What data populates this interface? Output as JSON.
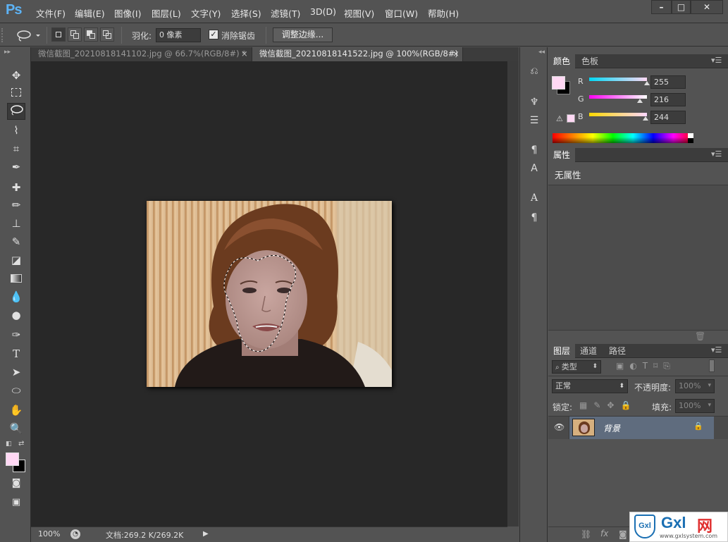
{
  "app": {
    "logo": "Ps"
  },
  "menu": [
    "文件(F)",
    "编辑(E)",
    "图像(I)",
    "图层(L)",
    "文字(Y)",
    "选择(S)",
    "滤镜(T)",
    "3D(D)",
    "视图(V)",
    "窗口(W)",
    "帮助(H)"
  ],
  "window_controls": {
    "minimize": "–",
    "maximize": "□",
    "close": "✕"
  },
  "options": {
    "feather_label": "羽化:",
    "feather_value": "0 像素",
    "antialias_label": "消除锯齿",
    "antialias_checked": true,
    "refine_edge_label": "调整边缘..."
  },
  "tabs": [
    {
      "title": "微信截图_20210818141102.jpg @ 66.7%(RGB/8#) *",
      "close": "×",
      "active": false
    },
    {
      "title": "微信截图_20210818141522.jpg @ 100%(RGB/8#)",
      "close": "×",
      "active": true
    }
  ],
  "status": {
    "zoom": "100%",
    "doc": "文档:269.2 K/269.2K"
  },
  "color_panel": {
    "tabs": [
      "颜色",
      "色板"
    ],
    "r_label": "R",
    "g_label": "G",
    "b_label": "B",
    "r": "255",
    "g": "216",
    "b": "244",
    "foreground": "#ffd8f4",
    "background": "#000000"
  },
  "properties_panel": {
    "tab": "属性",
    "content": "无属性"
  },
  "layers_panel": {
    "tabs": [
      "图层",
      "通道",
      "路径"
    ],
    "filter_label": "类型",
    "blend_mode": "正常",
    "opacity_label": "不透明度:",
    "opacity_value": "100%",
    "lock_label": "锁定:",
    "fill_label": "填充:",
    "fill_value": "100%",
    "layers": [
      {
        "name": "背景",
        "locked": true,
        "visible": true
      }
    ]
  },
  "watermark": {
    "brand": "Gxl",
    "suffix": "网",
    "url": "www.gxlsystem.com"
  }
}
